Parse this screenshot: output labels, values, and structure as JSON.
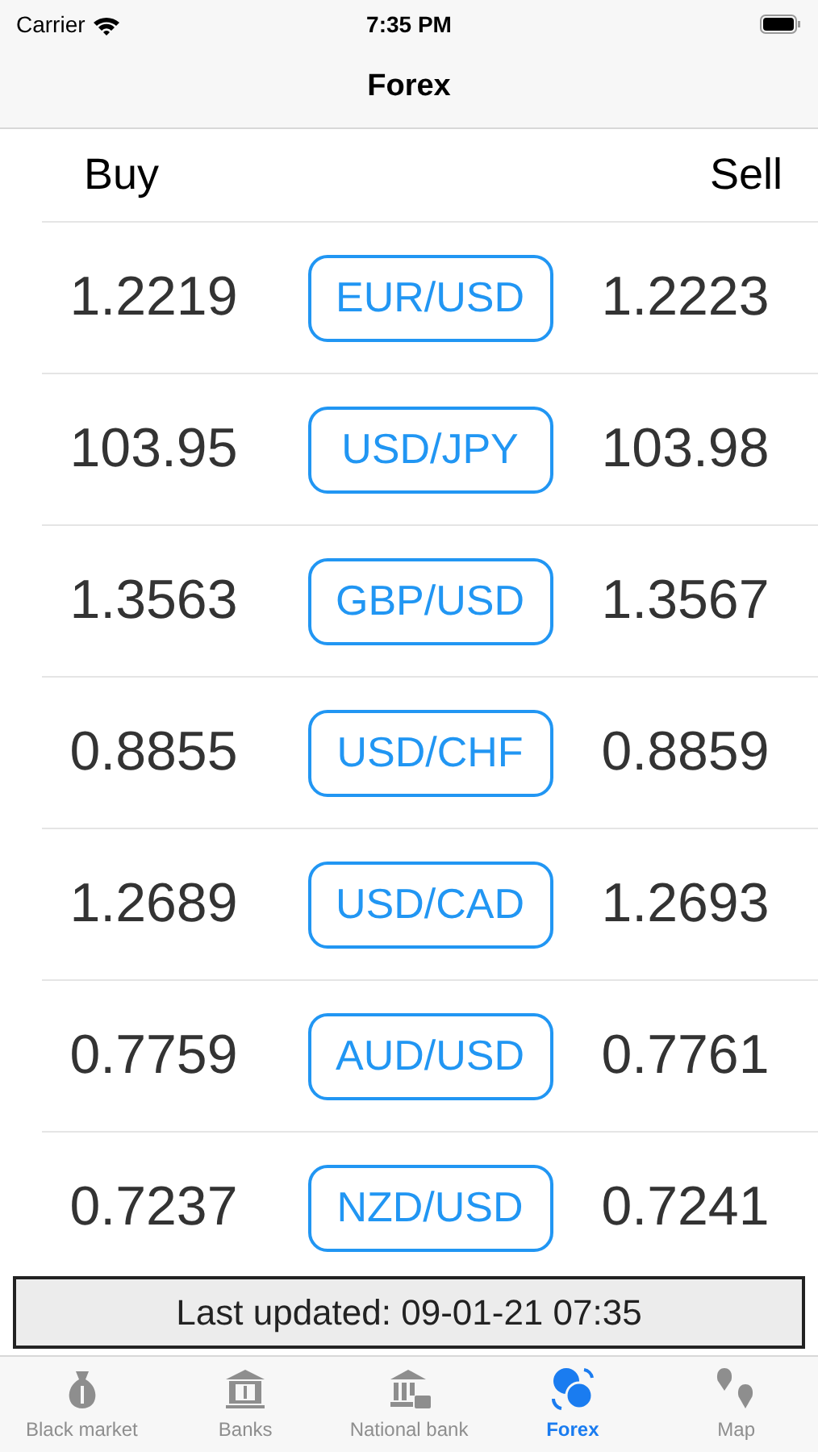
{
  "status_bar": {
    "carrier": "Carrier",
    "time": "7:35 PM"
  },
  "nav": {
    "title": "Forex"
  },
  "header": {
    "buy": "Buy",
    "sell": "Sell"
  },
  "rows": [
    {
      "buy": "1.2219",
      "pair": "EUR/USD",
      "sell": "1.2223"
    },
    {
      "buy": "103.95",
      "pair": "USD/JPY",
      "sell": "103.98"
    },
    {
      "buy": "1.3563",
      "pair": "GBP/USD",
      "sell": "1.3567"
    },
    {
      "buy": "0.8855",
      "pair": "USD/CHF",
      "sell": "0.8859"
    },
    {
      "buy": "1.2689",
      "pair": "USD/CAD",
      "sell": "1.2693"
    },
    {
      "buy": "0.7759",
      "pair": "AUD/USD",
      "sell": "0.7761"
    },
    {
      "buy": "0.7237",
      "pair": "NZD/USD",
      "sell": "0.7241"
    }
  ],
  "last_updated": "Last updated: 09-01-21 07:35",
  "tab_bar": [
    {
      "kind": "bag",
      "label": "Black market",
      "selected": false
    },
    {
      "kind": "bank",
      "label": "Banks",
      "selected": false
    },
    {
      "kind": "building",
      "label": "National bank",
      "selected": false
    },
    {
      "kind": "exchange",
      "label": "Forex",
      "selected": true
    },
    {
      "kind": "map",
      "label": "Map",
      "selected": false
    }
  ]
}
